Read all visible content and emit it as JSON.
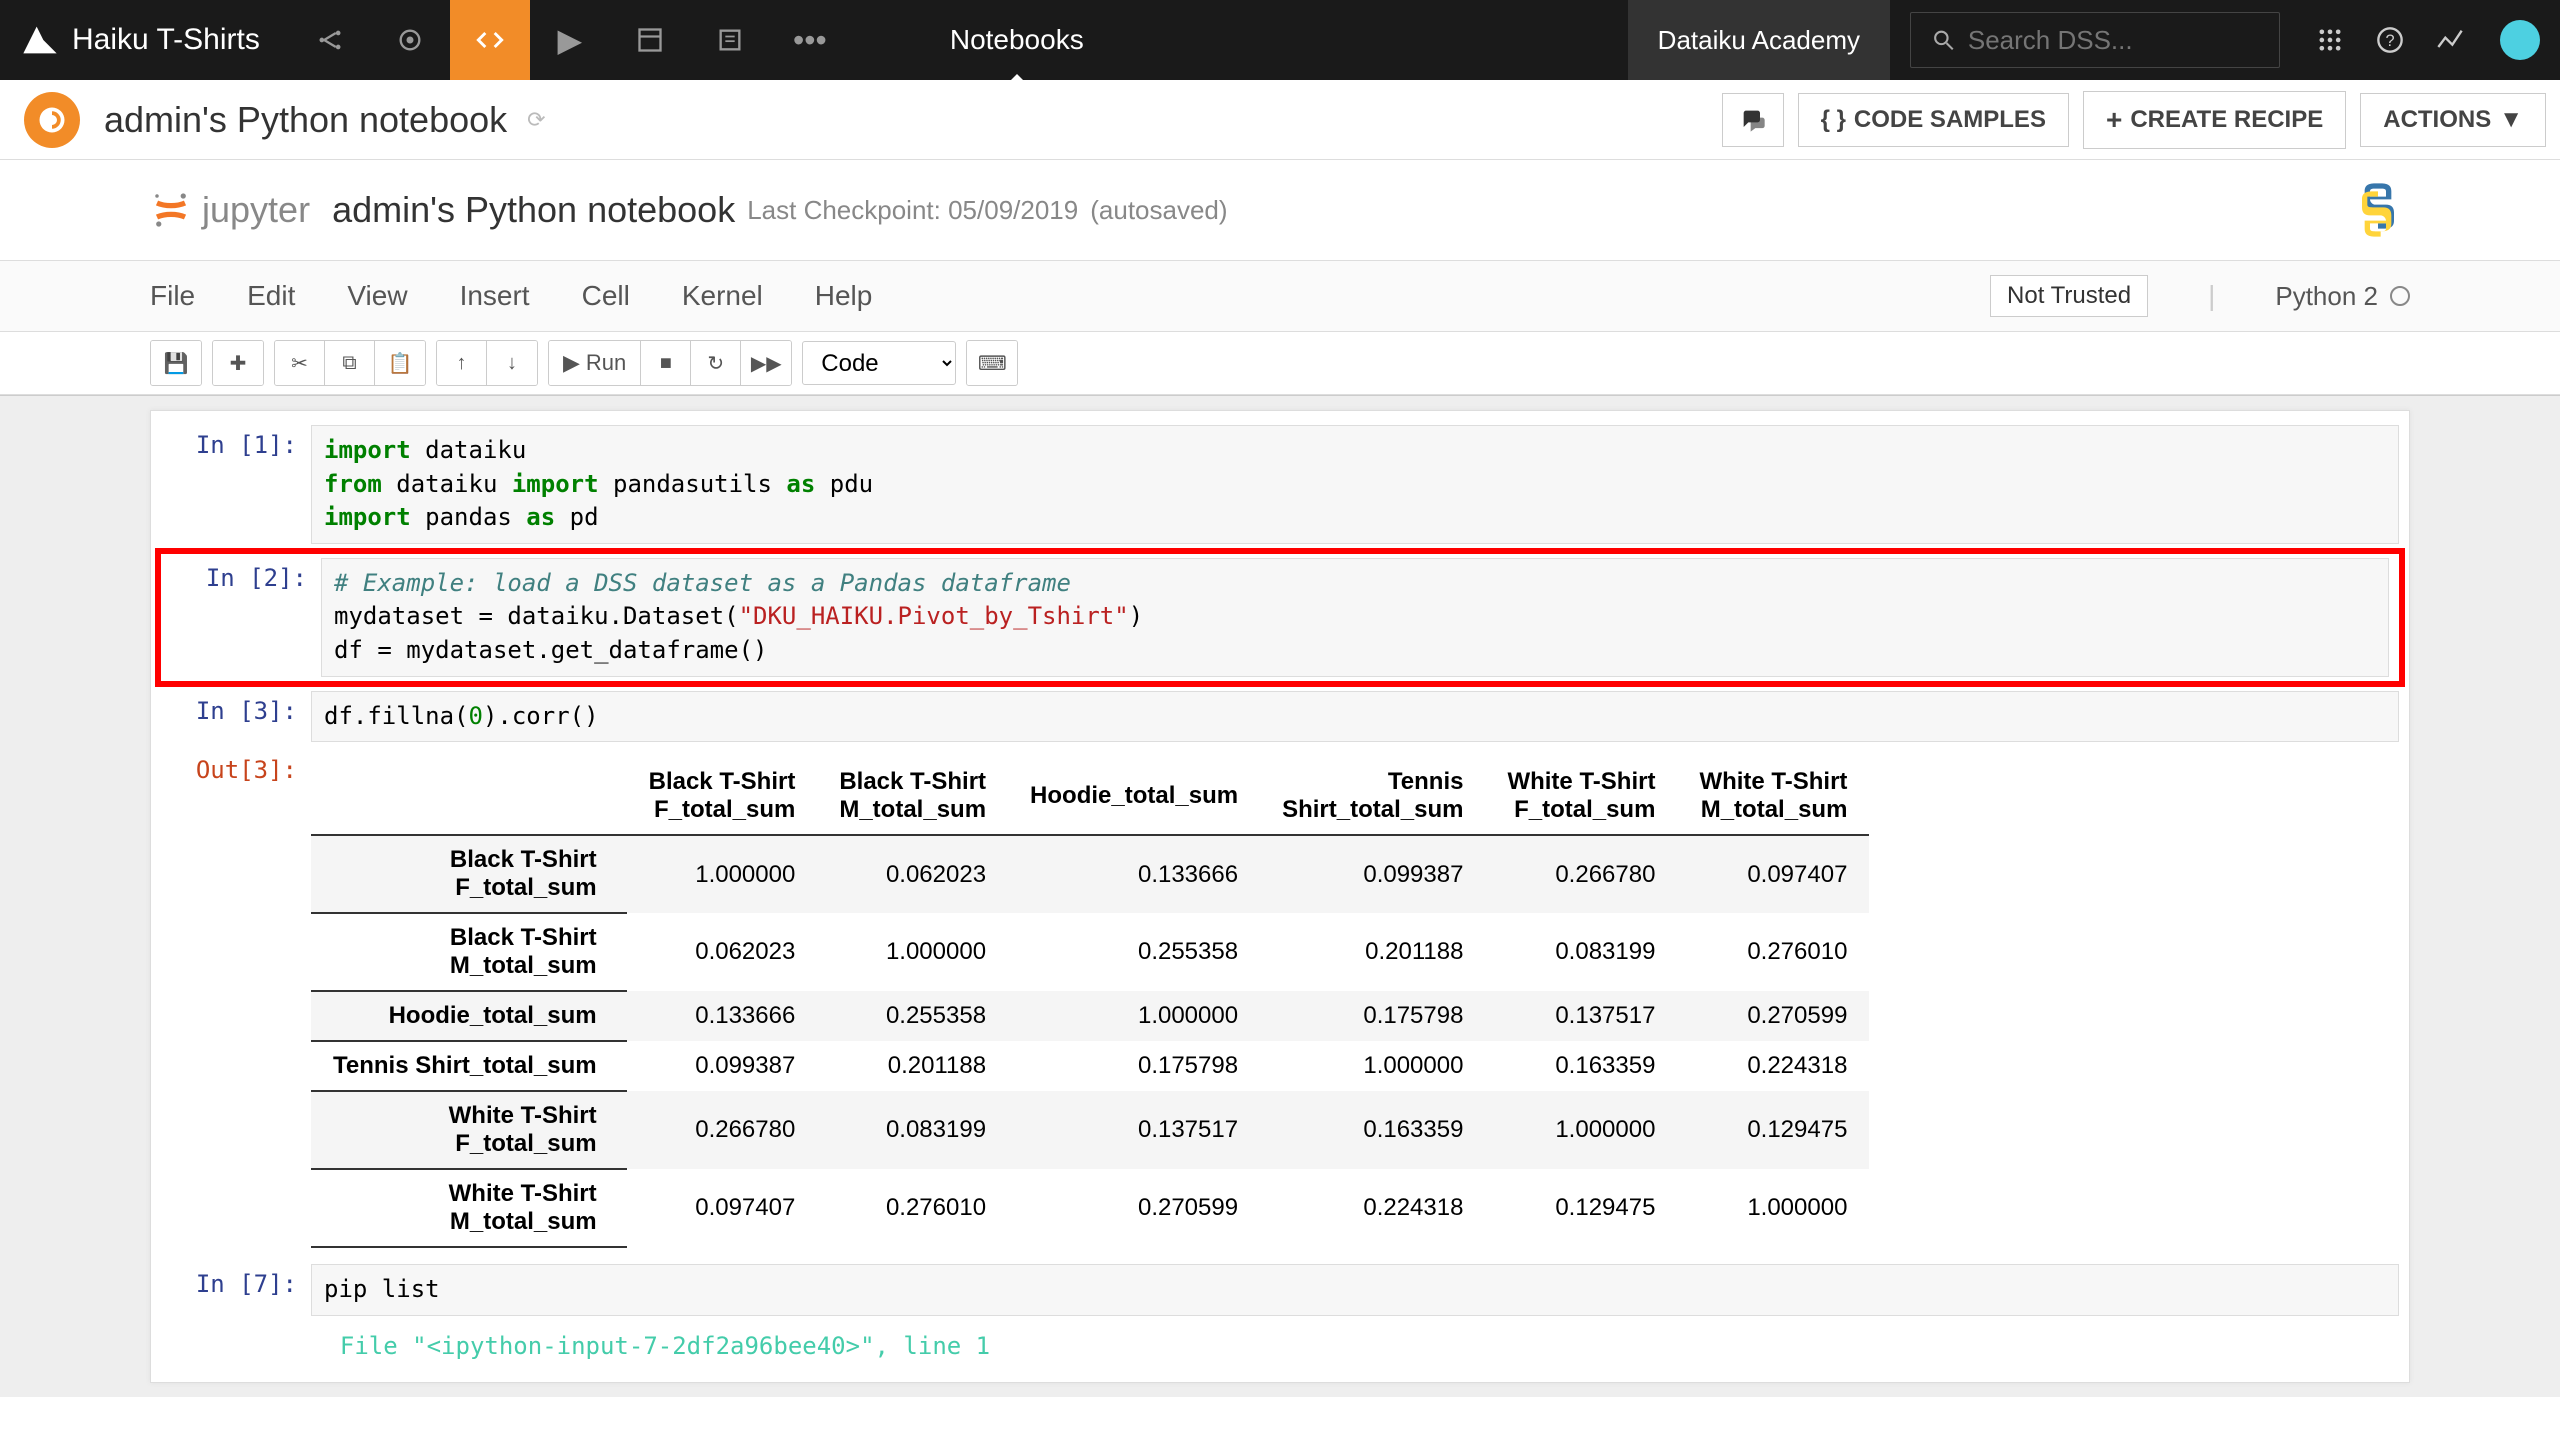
{
  "nav": {
    "project": "Haiku T-Shirts",
    "center": "Notebooks",
    "academy": "Dataiku Academy",
    "search_placeholder": "Search DSS..."
  },
  "header": {
    "title": "admin's Python notebook",
    "code_samples": "CODE SAMPLES",
    "create_recipe": "CREATE RECIPE",
    "actions": "ACTIONS"
  },
  "jupyter": {
    "brand": "jupyter",
    "notebook_title": "admin's Python notebook",
    "checkpoint": "Last Checkpoint: 05/09/2019",
    "autosaved": "(autosaved)"
  },
  "menu": {
    "file": "File",
    "edit": "Edit",
    "view": "View",
    "insert": "Insert",
    "cell": "Cell",
    "kernel": "Kernel",
    "help": "Help",
    "not_trusted": "Not Trusted",
    "kernel_name": "Python 2"
  },
  "toolbar": {
    "run": "Run",
    "cell_type": "Code"
  },
  "cells": {
    "c1": {
      "prompt": "In [1]:"
    },
    "c2": {
      "prompt": "In [2]:"
    },
    "c3": {
      "prompt": "In [3]:",
      "out_prompt": "Out[3]:",
      "code": "df.fillna(0).corr()"
    },
    "c7": {
      "prompt": "In [7]:",
      "code": "pip list"
    },
    "err": "  File \"<ipython-input-7-2df2a96bee40>\", line 1"
  },
  "table": {
    "cols": [
      "Black T-Shirt F_total_sum",
      "Black T-Shirt M_total_sum",
      "Hoodie_total_sum",
      "Tennis Shirt_total_sum",
      "White T-Shirt F_total_sum",
      "White T-Shirt M_total_sum"
    ],
    "rows": [
      {
        "h": "Black T-Shirt F_total_sum",
        "v": [
          "1.000000",
          "0.062023",
          "0.133666",
          "0.099387",
          "0.266780",
          "0.097407"
        ]
      },
      {
        "h": "Black T-Shirt M_total_sum",
        "v": [
          "0.062023",
          "1.000000",
          "0.255358",
          "0.201188",
          "0.083199",
          "0.276010"
        ]
      },
      {
        "h": "Hoodie_total_sum",
        "v": [
          "0.133666",
          "0.255358",
          "1.000000",
          "0.175798",
          "0.137517",
          "0.270599"
        ]
      },
      {
        "h": "Tennis Shirt_total_sum",
        "v": [
          "0.099387",
          "0.201188",
          "0.175798",
          "1.000000",
          "0.163359",
          "0.224318"
        ]
      },
      {
        "h": "White T-Shirt F_total_sum",
        "v": [
          "0.266780",
          "0.083199",
          "0.137517",
          "0.163359",
          "1.000000",
          "0.129475"
        ]
      },
      {
        "h": "White T-Shirt M_total_sum",
        "v": [
          "0.097407",
          "0.276010",
          "0.270599",
          "0.224318",
          "0.129475",
          "1.000000"
        ]
      }
    ]
  }
}
